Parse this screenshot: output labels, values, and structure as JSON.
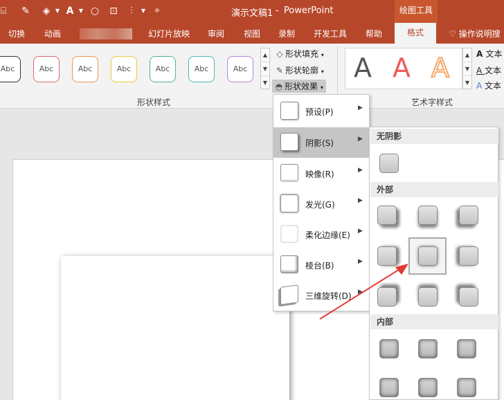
{
  "title_bar": {
    "doc_title": "演示文稿1",
    "separator": "-",
    "app_name": "PowerPoint",
    "contextual_group": "绘图工具",
    "quick_access": [
      "save-icon",
      "eyedropper-icon",
      "fill-bucket-icon",
      "font-color-icon",
      "shape-circle-icon",
      "select-icon",
      "brush-icon",
      "customize-icon"
    ]
  },
  "tabs": {
    "items": [
      "切换",
      "动画",
      "幻灯片放映",
      "审阅",
      "视图",
      "录制",
      "开发工具",
      "帮助"
    ],
    "format": "格式",
    "tell_me": "操作说明搜"
  },
  "shape_styles": {
    "label": "形状样式",
    "samples": [
      {
        "text": "Abc",
        "color": "#333333"
      },
      {
        "text": "Abc",
        "color": "#e0666a"
      },
      {
        "text": "Abc",
        "color": "#e8974a"
      },
      {
        "text": "Abc",
        "color": "#f0c93a"
      },
      {
        "text": "Abc",
        "color": "#49b48e"
      },
      {
        "text": "Abc",
        "color": "#47b5b5"
      },
      {
        "text": "Abc",
        "color": "#b784d8"
      }
    ]
  },
  "format_buttons": {
    "fill": "形状填充",
    "outline": "形状轮廓",
    "effects": "形状效果"
  },
  "wordart": {
    "label": "艺术字样式",
    "samples": [
      {
        "text": "A",
        "color": "#555555"
      },
      {
        "text": "A",
        "color": "#ef5a5a"
      },
      {
        "text": "A",
        "color": "#f3a76a"
      }
    ],
    "text_options": [
      "文本",
      "文本",
      "文本"
    ]
  },
  "effects_menu": {
    "items": [
      {
        "label": "预设(P)"
      },
      {
        "label": "阴影(S)"
      },
      {
        "label": "映像(R)"
      },
      {
        "label": "发光(G)"
      },
      {
        "label": "柔化边缘(E)"
      },
      {
        "label": "棱台(B)"
      },
      {
        "label": "三维旋转(D)"
      }
    ],
    "active_index": 1
  },
  "shadow_submenu": {
    "no_shadow": "无阴影",
    "outer": "外部",
    "inner": "内部"
  },
  "colors": {
    "brand": "#b7472a",
    "annotation_arrow": "#e53935"
  }
}
